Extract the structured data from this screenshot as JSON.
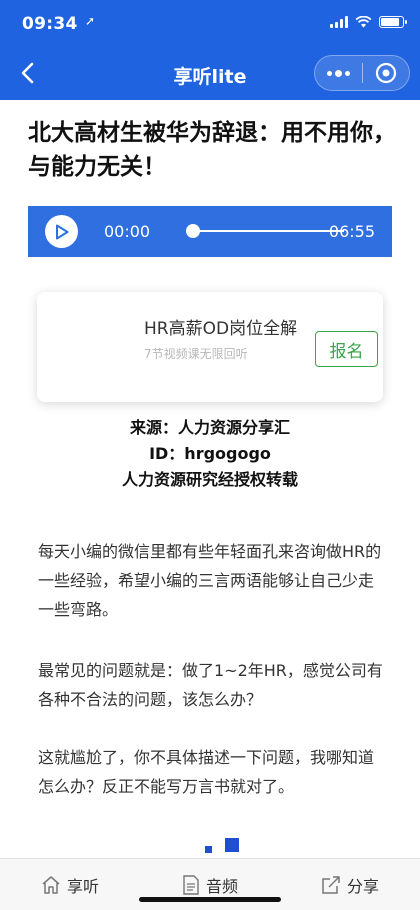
{
  "status": {
    "time": "09:34",
    "location_glyph": "➚"
  },
  "nav": {
    "title": "享听lite"
  },
  "article": {
    "title": "北大高材生被华为辞退：用不用你，与能力无关！"
  },
  "player": {
    "current": "00:00",
    "total": "06:55",
    "progress": 0
  },
  "course": {
    "title": "HR高薪OD岗位全解",
    "subtitle": "7节视频课无限回听",
    "button": "报名"
  },
  "source": {
    "line1": "来源：人力资源分享汇",
    "line2": "ID：hrgogogo",
    "line3": "人力资源研究经授权转载"
  },
  "paragraphs": [
    "每天小编的微信里都有些年轻面孔来咨询做HR的一些经验，希望小编的三言两语能够让自己少走一些弯路。",
    "最常见的问题就是：做了1~2年HR，感觉公司有各种不合法的问题，该怎么办？",
    "这就尴尬了，你不具体描述一下问题，我哪知道怎么办？反正不能写万言书就对了。"
  ],
  "tabs": [
    {
      "label": "享听",
      "icon": "home-icon"
    },
    {
      "label": "音频",
      "icon": "document-icon"
    },
    {
      "label": "分享",
      "icon": "share-icon"
    }
  ],
  "colors": {
    "brand": "#1f63e0",
    "player": "#2f6fe0",
    "signup": "#3aa54a"
  }
}
